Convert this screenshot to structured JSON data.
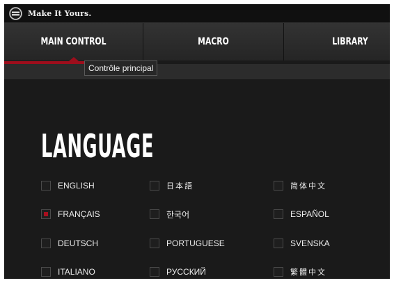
{
  "app": {
    "title": "Make It Yours.",
    "logo_text": "COOLER MASTER"
  },
  "tabs": [
    {
      "label": "MAIN CONTROL",
      "active": true
    },
    {
      "label": "MACRO",
      "active": false
    },
    {
      "label": "LIBRARY",
      "active": false
    }
  ],
  "tooltip": "Contrôle principal",
  "language_section": {
    "heading": "LANGUAGE",
    "selected": "FRANÇAIS",
    "languages": [
      {
        "label": "ENGLISH",
        "checked": false
      },
      {
        "label": "FRANÇAIS",
        "checked": true
      },
      {
        "label": "DEUTSCH",
        "checked": false
      },
      {
        "label": "ITALIANO",
        "checked": false
      },
      {
        "label": "日本語",
        "checked": false
      },
      {
        "label": "한국어",
        "checked": false
      },
      {
        "label": "PORTUGUESE",
        "checked": false
      },
      {
        "label": "РУССКИЙ",
        "checked": false
      },
      {
        "label": "简体中文",
        "checked": false
      },
      {
        "label": "ESPAÑOL",
        "checked": false
      },
      {
        "label": "SVENSKA",
        "checked": false
      },
      {
        "label": "繁體中文",
        "checked": false
      }
    ]
  },
  "colors": {
    "accent": "#9d0e1c",
    "background": "#1a1a1a",
    "text": "#ffffff"
  }
}
